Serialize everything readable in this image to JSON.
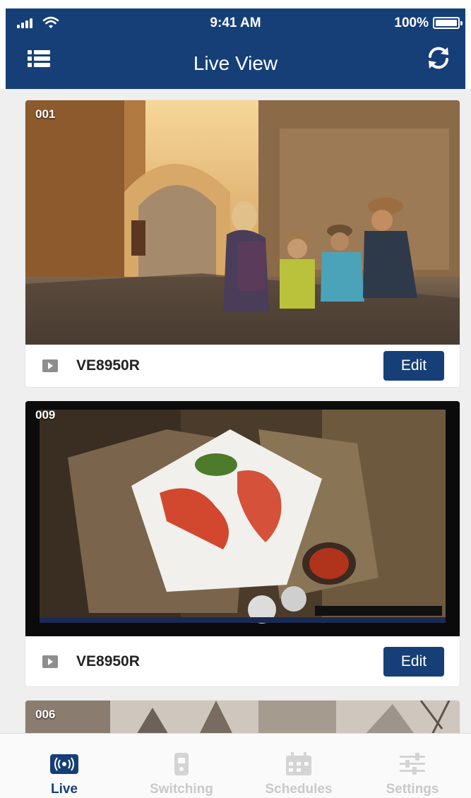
{
  "status_bar": {
    "time": "9:41 AM",
    "battery": "100%"
  },
  "header": {
    "title": "Live View"
  },
  "cameras": [
    {
      "number": "001",
      "name": "VE8950R",
      "edit_label": "Edit"
    },
    {
      "number": "009",
      "name": "VE8950R",
      "edit_label": "Edit"
    },
    {
      "number": "006"
    }
  ],
  "tabs": [
    {
      "label": "Live",
      "icon": "live-broadcast-icon",
      "active": true
    },
    {
      "label": "Switching",
      "icon": "remote-switch-icon",
      "active": false
    },
    {
      "label": "Schedules",
      "icon": "calendar-icon",
      "active": false
    },
    {
      "label": "Settings",
      "icon": "sliders-icon",
      "active": false
    }
  ],
  "colors": {
    "primary": "#163f78",
    "background": "#efefef",
    "inactive_tab": "#c9c9c9"
  }
}
